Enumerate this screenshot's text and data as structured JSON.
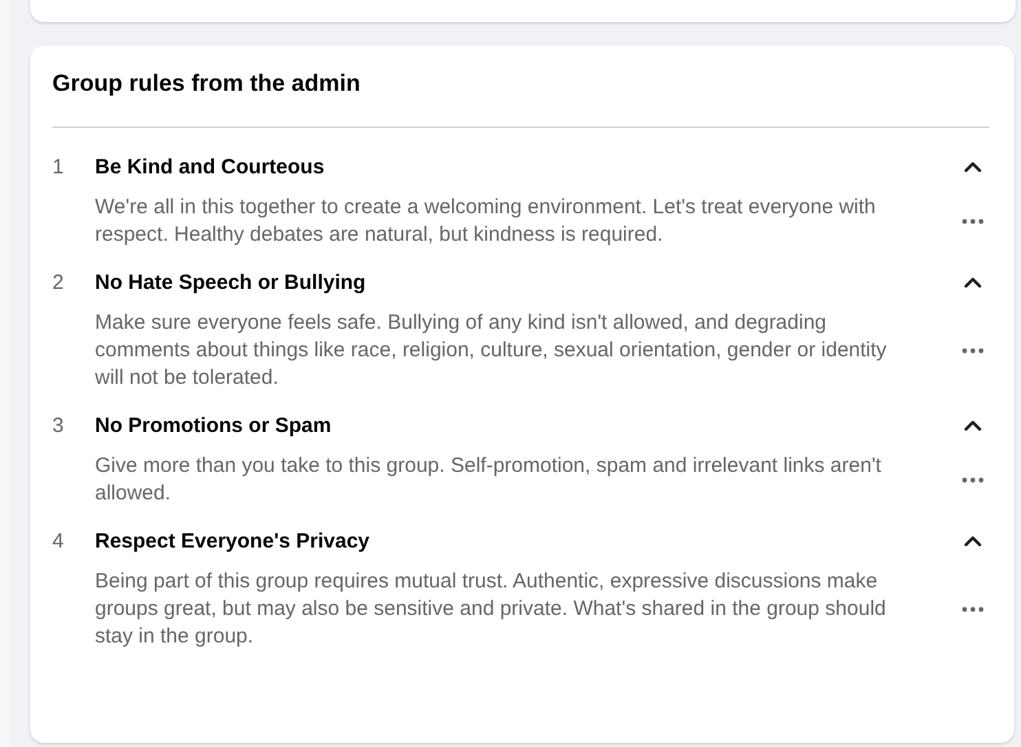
{
  "title": "Group rules from the admin",
  "rules": [
    {
      "number": "1",
      "title": "Be Kind and Courteous",
      "expanded": true,
      "description": "We're all in this together to create a welcoming environment. Let's treat everyone with respect. Healthy debates are natural, but kindness is required."
    },
    {
      "number": "2",
      "title": "No Hate Speech or Bullying",
      "expanded": true,
      "description": "Make sure everyone feels safe. Bullying of any kind isn't allowed, and degrading comments about things like race, religion, culture, sexual orientation, gender or identity will not be tolerated."
    },
    {
      "number": "3",
      "title": "No Promotions or Spam",
      "expanded": true,
      "description": "Give more than you take to this group. Self-promotion, spam and irrelevant links aren't allowed."
    },
    {
      "number": "4",
      "title": "Respect Everyone's Privacy",
      "expanded": true,
      "description": "Being part of this group requires mutual trust. Authentic, expressive discussions make groups great, but may also be sensitive and private. What's shared in the group should stay in the group."
    }
  ]
}
